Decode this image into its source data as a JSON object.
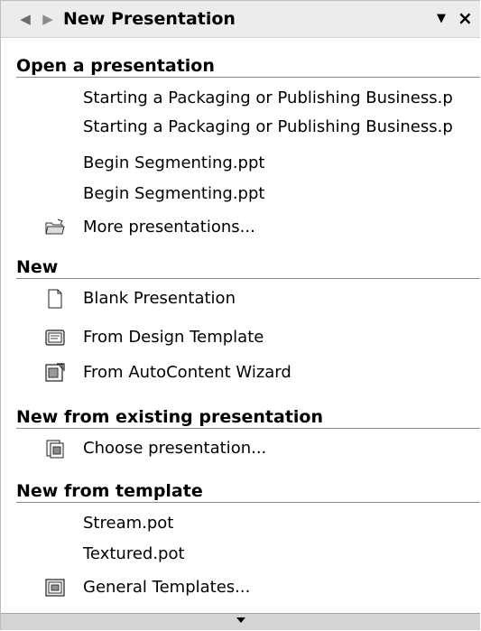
{
  "pane": {
    "title": "New Presentation",
    "back_icon": "back-arrow-icon",
    "forward_icon": "forward-arrow-icon",
    "dropdown_icon": "dropdown-triangle-icon",
    "close_label": "×"
  },
  "open_section": {
    "title": "Open a presentation",
    "files": [
      "Starting a Packaging or Publishing Business.p",
      "Starting a Packaging or Publishing Business.p",
      "Begin Segmenting.ppt",
      "Begin Segmenting.ppt"
    ],
    "more": "More presentations..."
  },
  "new_section": {
    "title": "New",
    "blank": "Blank Presentation",
    "design_template": "From Design Template",
    "autocontent": "From AutoContent Wizard"
  },
  "existing_section": {
    "title": "New from existing presentation",
    "choose": "Choose presentation..."
  },
  "template_section": {
    "title": "New from template",
    "templates": [
      "Stream.pot",
      "Textured.pot"
    ],
    "general": "General Templates..."
  },
  "scroll": {
    "icon": "scroll-down-arrow-icon"
  }
}
